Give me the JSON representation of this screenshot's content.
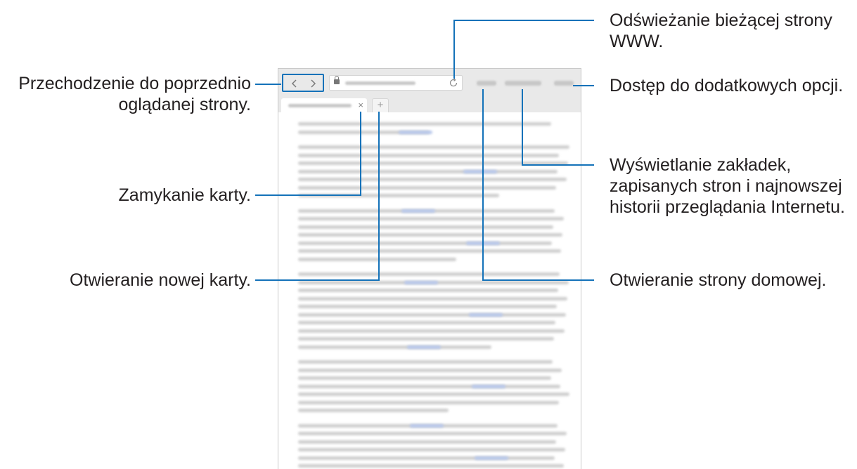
{
  "callouts": {
    "refresh": [
      "Odświeżanie bieżącej strony",
      "WWW."
    ],
    "back": [
      "Przechodzenie do poprzednio",
      "oglądanej strony."
    ],
    "more_options": [
      "Dostęp do dodatkowych opcji."
    ],
    "bookmarks": [
      "Wyświetlanie zakładek,",
      "zapisanych stron i najnowszej",
      "historii przeglądania Internetu."
    ],
    "close_tab": [
      "Zamykanie karty."
    ],
    "new_tab": [
      "Otwieranie nowej karty."
    ],
    "home": [
      "Otwieranie strony domowej."
    ]
  },
  "browser": {
    "back_icon": "chevron-left-icon",
    "forward_icon": "chevron-right-icon",
    "lock_icon": "lock-icon",
    "reload_icon": "reload-icon",
    "tab_close_glyph": "×",
    "new_tab_glyph": "+"
  },
  "colors": {
    "accent": "#1472b9",
    "toolbar": "#e9e9e9",
    "text": "#231f20"
  }
}
